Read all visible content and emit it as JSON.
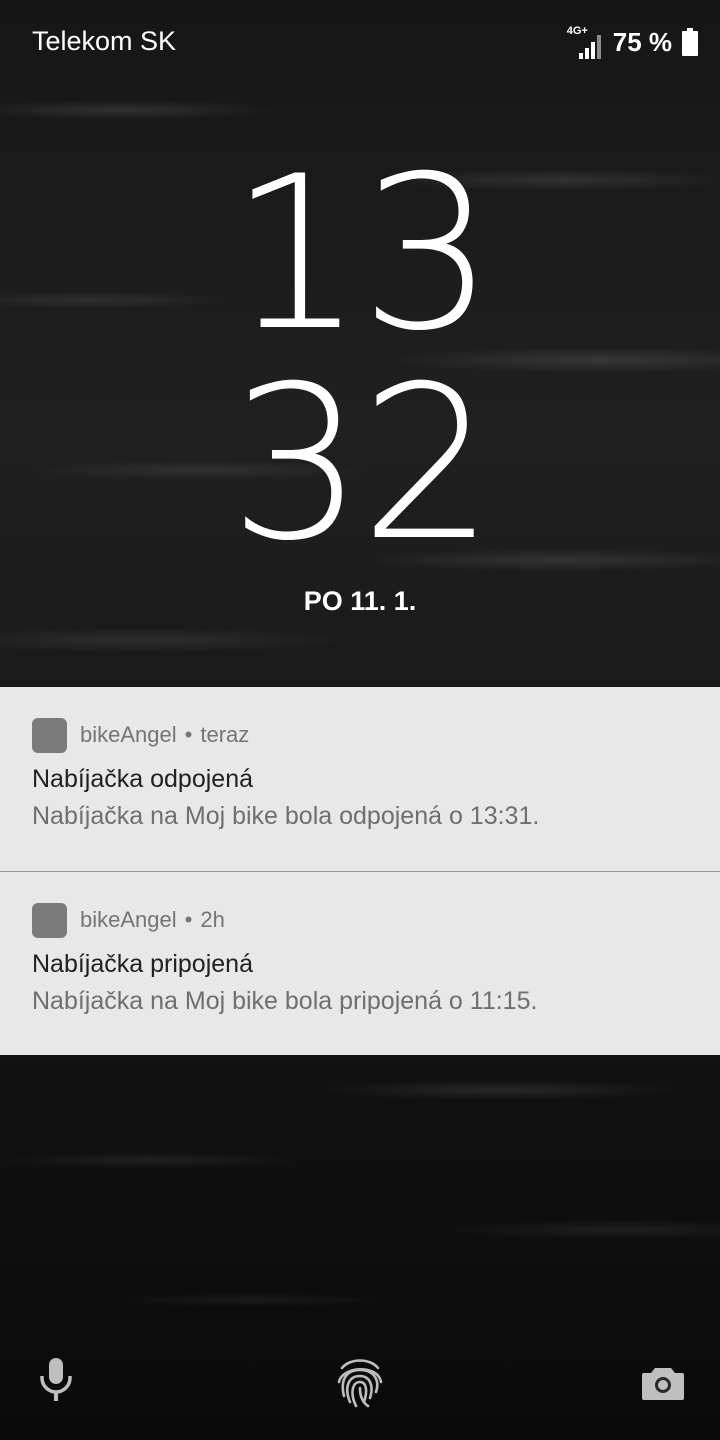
{
  "status_bar": {
    "carrier": "Telekom SK",
    "network_type": "4G+",
    "battery_percent": "75 %"
  },
  "lock_screen": {
    "hours": "13",
    "minutes": "32",
    "date": "PO 11. 1."
  },
  "notifications": [
    {
      "app": "bikeAngel",
      "separator": "•",
      "time": "teraz",
      "title": "Nabíjačka odpojená",
      "text": "Nabíjačka na Moj bike bola odpojená o 13:31."
    },
    {
      "app": "bikeAngel",
      "separator": "•",
      "time": "2h",
      "title": "Nabíjačka pripojená",
      "text": "Nabíjačka na Moj bike bola pripojená o 11:15."
    }
  ],
  "bottom_shortcuts": {
    "left": "microphone-icon",
    "center": "fingerprint-icon",
    "right": "camera-icon"
  }
}
